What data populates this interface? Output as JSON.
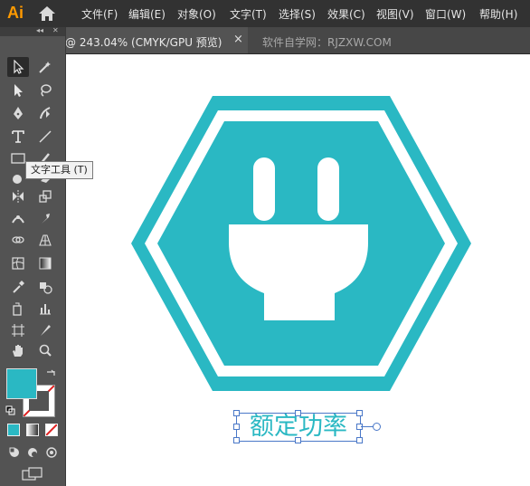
{
  "app": {
    "logo": "Ai"
  },
  "menu": [
    "文件(F)",
    "编辑(E)",
    "对象(O)",
    "文字(T)",
    "选择(S)",
    "效果(C)",
    "视图(V)",
    "窗口(W)",
    "帮助(H)"
  ],
  "tabs": {
    "active_title": "@ 243.04% (CMYK/GPU 预览)",
    "close": "×",
    "inactive_title": "软件自学网：RJZXW.COM"
  },
  "tooltip": "文字工具 (T)",
  "artwork": {
    "text": "额定功率",
    "color": "#2ab8c3"
  },
  "swatches": {
    "fill": "#2ab8c3",
    "stroke": "none"
  }
}
